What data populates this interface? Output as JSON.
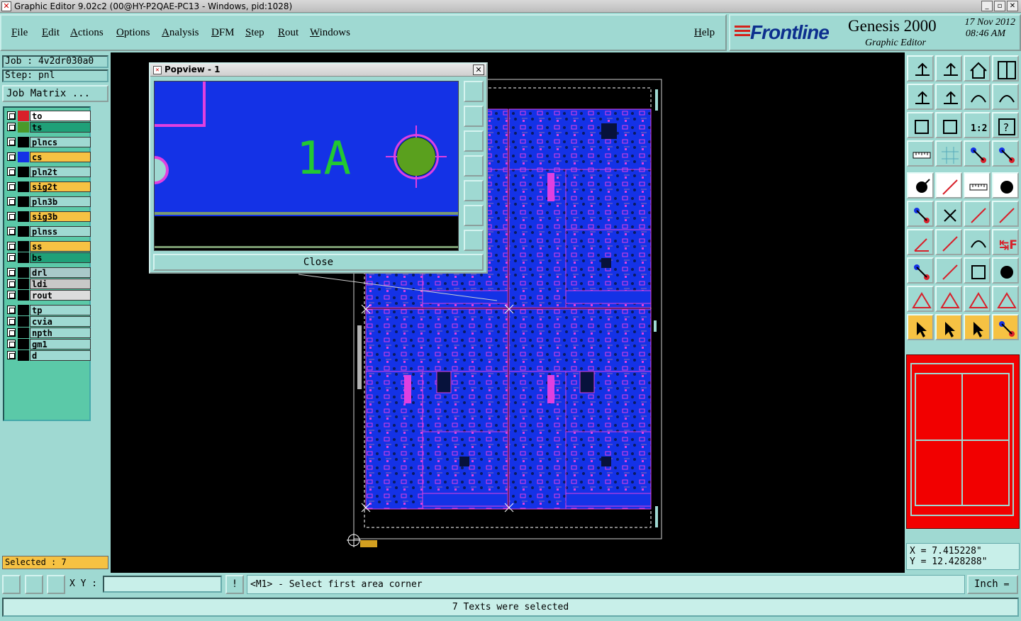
{
  "window": {
    "title": "Graphic Editor 9.02c2 (00@HY-P2QAE-PC13 - Windows, pid:1028)"
  },
  "menu": [
    "File",
    "Edit",
    "Actions",
    "Options",
    "Analysis",
    "DFM",
    "Step",
    "Rout",
    "Windows"
  ],
  "help": "Help",
  "brand": {
    "company": "Frontline",
    "product": "Genesis 2000",
    "subtitle": "Graphic Editor",
    "date": "17 Nov 2012",
    "time": "08:46 AM"
  },
  "job": {
    "label": "Job : 4v2dr030a0",
    "step": "Step: pnl",
    "matrix_button": "Job Matrix ..."
  },
  "layers": [
    {
      "name": "to",
      "color": "#ffffff",
      "swatch": "#d8202a"
    },
    {
      "name": "ts",
      "color": "#1fa078",
      "swatch": "#4a9a2a"
    },
    {
      "name": "plncs",
      "color": "#9fd9d2",
      "swatch": "#000000"
    },
    {
      "name": "cs",
      "color": "#f6c243",
      "swatch": "#1432e6"
    },
    {
      "name": "pln2t",
      "color": "#9fd9d2",
      "swatch": "#000000"
    },
    {
      "name": "sig2t",
      "color": "#f6c243",
      "swatch": "#000000"
    },
    {
      "name": "pln3b",
      "color": "#9fd9d2",
      "swatch": "#000000"
    },
    {
      "name": "sig3b",
      "color": "#f6c243",
      "swatch": "#000000"
    },
    {
      "name": "plnss",
      "color": "#9fd9d2",
      "swatch": "#000000"
    },
    {
      "name": "ss",
      "color": "#f6c243",
      "swatch": "#000000"
    },
    {
      "name": "bs",
      "color": "#1fa078",
      "swatch": "#000000"
    },
    {
      "name": "drl",
      "color": "#a9c9c9",
      "swatch": "#000000"
    },
    {
      "name": "ldi",
      "color": "#c8c8c8",
      "swatch": "#000000"
    },
    {
      "name": "rout",
      "color": "#dcdcdc",
      "swatch": "#000000"
    },
    {
      "name": "tp",
      "color": "#9fd9d2",
      "swatch": "#000000"
    },
    {
      "name": "cvia",
      "color": "#9fd9d2",
      "swatch": "#000000"
    },
    {
      "name": "npth",
      "color": "#9fd9d2",
      "swatch": "#000000"
    },
    {
      "name": "gm1",
      "color": "#9fd9d2",
      "swatch": "#000000"
    },
    {
      "name": "d",
      "color": "#9fd9d2",
      "swatch": "#000000"
    }
  ],
  "selected_label": "Selected : 7",
  "popview": {
    "title": "Popview - 1",
    "text": "1A",
    "close": "Close"
  },
  "coords": {
    "x": "X = 7.415228\"",
    "y": "Y = 12.428288\""
  },
  "bottom": {
    "xy_label": "X Y :",
    "xy_value": "",
    "prompt": "<M1> - Select first area corner",
    "unit": "Inch"
  },
  "status": "7 Texts were selected",
  "colors": {
    "panel": "#9fd9d2",
    "board": "#1432e6",
    "silk": "#e040e0",
    "highlight": "#f6c243"
  }
}
